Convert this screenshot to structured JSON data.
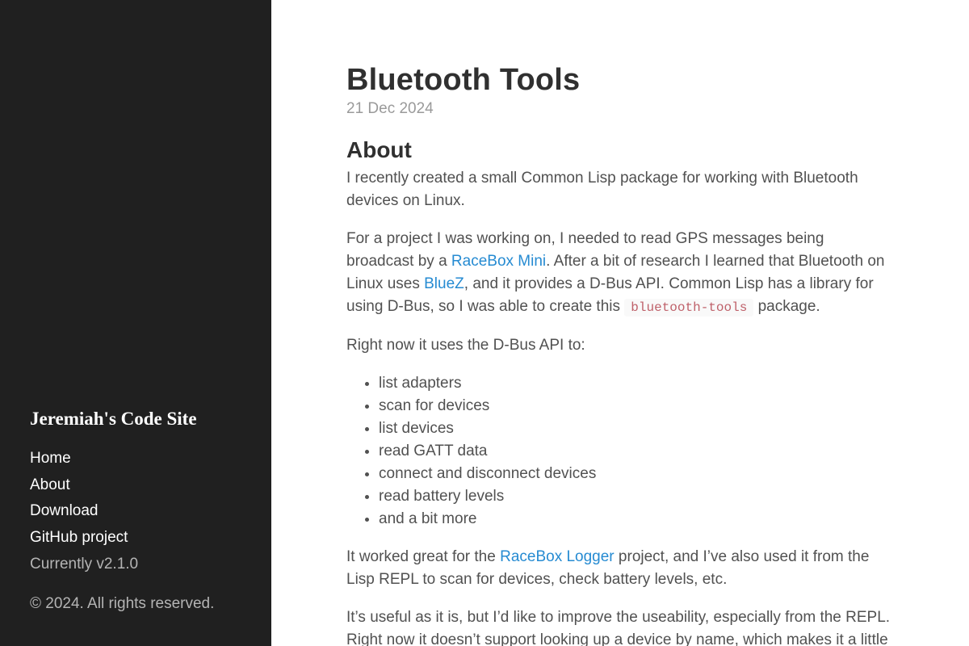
{
  "sidebar": {
    "site_title": "Jeremiah's Code Site",
    "nav": [
      {
        "label": "Home"
      },
      {
        "label": "About"
      },
      {
        "label": "Download"
      },
      {
        "label": "GitHub project"
      }
    ],
    "version": "Currently v2.1.0",
    "copyright": "© 2024. All rights reserved."
  },
  "post": {
    "title": "Bluetooth Tools",
    "date": "21 Dec 2024",
    "section_title": "About",
    "p1": "I recently created a small Common Lisp package for working with Bluetooth devices on Linux.",
    "p2": {
      "t1": "For a project I was working on, I needed to read GPS messages being broadcast by a ",
      "link1": "RaceBox Mini",
      "t2": ". After a bit of research I learned that Bluetooth on Linux uses ",
      "link2": "BlueZ",
      "t3": ", and it provides a D-Bus API. Common Lisp has a library for using D-Bus, so I was able to create this ",
      "code": "bluetooth-tools",
      "t4": " package."
    },
    "p3": "Right now it uses the D-Bus API to:",
    "features": [
      "list adapters",
      "scan for devices",
      "list devices",
      "read GATT data",
      "connect and disconnect devices",
      "read battery levels",
      "and a bit more"
    ],
    "p4": {
      "t1": "It worked great for the ",
      "link": "RaceBox Logger",
      "t2": " project, and I’ve also used it from the Lisp REPL to scan for devices, check battery levels, etc."
    },
    "p5": "It’s useful as it is, but I’d like to improve the useability, especially from the REPL. Right now it doesn’t support looking up a device by name, which makes it a little"
  }
}
